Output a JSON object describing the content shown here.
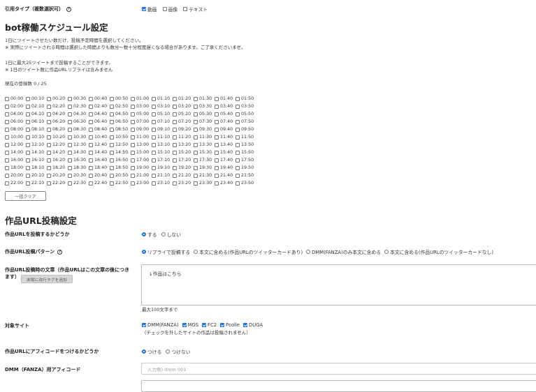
{
  "quote_type": {
    "label": "引用タイプ（複数選択可）",
    "options": [
      {
        "label": "動画",
        "checked": true
      },
      {
        "label": "画像",
        "checked": false
      },
      {
        "label": "テキスト",
        "checked": false
      }
    ]
  },
  "schedule": {
    "title": "bot稼働スケジュール設定",
    "desc1": "1日にツイートさせたい数だけ、投稿予定時間を選択してください。",
    "desc2": "※ 実際にツイートされる時間は選択した時間よりも数分〜数十分程度遅くなる場合があります。ご了承くださいませ。",
    "desc3": "1日に最大25ツイートまで投稿することができます。",
    "desc4": "※ 1日のツイート数に作品URLリプライは含みません",
    "count": "現在の登録数 0 / 25",
    "times": [
      [
        "00:00",
        "00:10",
        "00:20",
        "00:30",
        "00:40",
        "00:50",
        "01:00",
        "01:10",
        "01:20",
        "01:30",
        "01:40",
        "01:50"
      ],
      [
        "02:00",
        "02:10",
        "02:20",
        "02:30",
        "02:40",
        "02:50",
        "03:00",
        "03:10",
        "03:20",
        "03:30",
        "03:40",
        "03:50"
      ],
      [
        "04:00",
        "04:10",
        "04:20",
        "04:30",
        "04:40",
        "04:50",
        "05:00",
        "05:10",
        "05:20",
        "05:30",
        "05:40",
        "05:50"
      ],
      [
        "06:00",
        "06:10",
        "06:20",
        "06:30",
        "06:40",
        "06:50",
        "07:00",
        "07:10",
        "07:20",
        "07:30",
        "07:40",
        "07:50"
      ],
      [
        "08:00",
        "08:10",
        "08:20",
        "08:30",
        "08:40",
        "08:50",
        "09:00",
        "09:10",
        "09:20",
        "09:30",
        "09:40",
        "09:50"
      ],
      [
        "10:00",
        "10:10",
        "10:20",
        "10:30",
        "10:40",
        "10:50",
        "11:00",
        "11:10",
        "11:20",
        "11:30",
        "11:40",
        "11:50"
      ],
      [
        "12:00",
        "12:10",
        "12:20",
        "12:30",
        "12:40",
        "12:50",
        "13:00",
        "13:10",
        "13:20",
        "13:30",
        "13:40",
        "13:50"
      ],
      [
        "14:00",
        "14:10",
        "14:20",
        "14:30",
        "14:40",
        "14:50",
        "15:00",
        "15:10",
        "15:20",
        "15:30",
        "15:40",
        "15:50"
      ],
      [
        "16:00",
        "16:10",
        "16:20",
        "16:30",
        "16:40",
        "16:50",
        "17:00",
        "17:10",
        "17:20",
        "17:30",
        "17:40",
        "17:50"
      ],
      [
        "18:00",
        "18:10",
        "18:20",
        "18:30",
        "18:40",
        "18:50",
        "19:00",
        "19:10",
        "19:20",
        "19:30",
        "19:40",
        "19:50"
      ],
      [
        "20:00",
        "20:10",
        "20:20",
        "20:30",
        "20:40",
        "20:50",
        "21:00",
        "21:10",
        "21:20",
        "21:30",
        "21:40",
        "21:50"
      ],
      [
        "22:00",
        "22:10",
        "22:20",
        "22:30",
        "22:40",
        "22:50",
        "23:00",
        "23:10",
        "23:20",
        "23:30",
        "23:40",
        "23:50"
      ]
    ],
    "clear_label": "一括クリア"
  },
  "url_settings": {
    "title": "作品URL投稿設定",
    "post_url": {
      "label": "作品URLを投稿するかどうか",
      "options": [
        {
          "label": "する",
          "selected": true
        },
        {
          "label": "しない",
          "selected": false
        }
      ]
    },
    "pattern": {
      "label": "作品URL投稿パターン",
      "options": [
        {
          "label": "リプライで投稿する",
          "selected": true
        },
        {
          "label": "本文に含める(作品URLのツイッターカードあり)",
          "selected": false
        },
        {
          "label": "DMM(FANZA)のみ本文に含める",
          "selected": false
        },
        {
          "label": "本文に含める(作品URLのツイッターカードなし)",
          "selected": false
        }
      ]
    },
    "text": {
      "label": "作品URL投稿時の文章（作品URLはこの文章の後につきます）",
      "add_tag_label": "末尾に改行タグを追加",
      "value": "↓作品はこちら",
      "limit_note": "最大100文字まで"
    },
    "sites": {
      "label": "対象サイト",
      "options": [
        {
          "label": "DMM(FANZA)",
          "checked": true
        },
        {
          "label": "MGS",
          "checked": true
        },
        {
          "label": "FC2",
          "checked": true
        },
        {
          "label": "Pcolle",
          "checked": true
        },
        {
          "label": "DUGA",
          "checked": true
        }
      ],
      "note": "（チェックを外したサイトの作品は投稿されません）"
    },
    "affiliate": {
      "label": "作品URLにアフィコードをつけるかどうか",
      "options": [
        {
          "label": "つける",
          "selected": true
        },
        {
          "label": "つけない",
          "selected": false
        }
      ]
    },
    "dmm_code": {
      "label": "DMM（FANZA）用アフィコード",
      "placeholder": "入力例) dmm 001"
    }
  },
  "colors": {
    "accent": "#1a73e8"
  }
}
